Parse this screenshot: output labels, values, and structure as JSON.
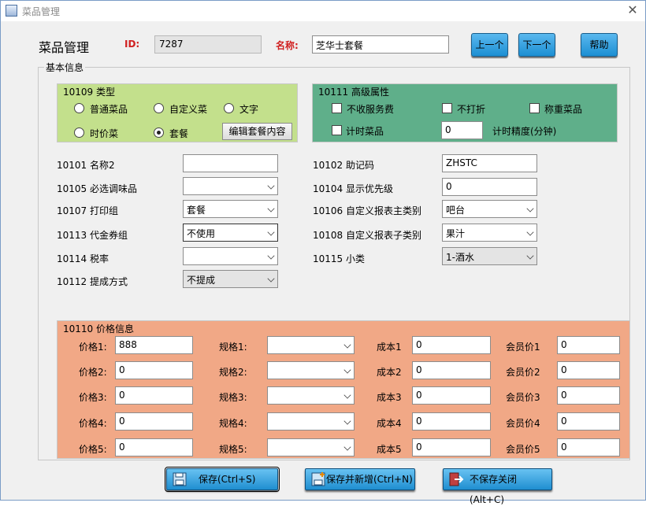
{
  "window": {
    "title": "菜品管理",
    "close_icon": "close-icon"
  },
  "header": {
    "title": "菜品管理",
    "id_label": "ID:",
    "id_value": "7287",
    "name_label": "名称:",
    "name_value": "芝华士套餐",
    "prev": "上一个",
    "next": "下一个",
    "help": "帮助"
  },
  "basic": {
    "group_label": "基本信息"
  },
  "type_group": {
    "label": "10109 类型",
    "options": [
      "普通菜品",
      "自定义菜",
      "文字",
      "时价菜",
      "套餐"
    ],
    "selected": "套餐",
    "edit_btn": "编辑套餐内容"
  },
  "advanced": {
    "label": "10111 高级属性",
    "no_service": "不收服务费",
    "no_discount": "不打折",
    "weigh": "称重菜品",
    "timed": "计时菜品",
    "precision_value": "0",
    "precision_label": "计时精度(分钟)"
  },
  "fields": {
    "name2_label": "10101 名称2",
    "name2_value": "",
    "mnemonic_label": "10102 助记码",
    "mnemonic_value": "ZHSTC",
    "seasoning_label": "10105 必选调味品",
    "seasoning_value": "",
    "priority_label": "10104 显示优先级",
    "priority_value": "0",
    "print_label": "10107 打印组",
    "print_value": "套餐",
    "report_main_label": "10106 自定义报表主类别",
    "report_main_value": "吧台",
    "coupon_label": "10113 代金券组",
    "coupon_value": "不使用",
    "report_sub_label": "10108 自定义报表子类别",
    "report_sub_value": "果汁",
    "tax_label": "10114 税率",
    "tax_value": "",
    "subclass_label": "10115 小类",
    "subclass_value": "1-酒水",
    "commission_label": "10112 提成方式",
    "commission_value": "不提成"
  },
  "price": {
    "label": "10110 价格信息",
    "rows": [
      {
        "price_label": "价格1:",
        "price": "888",
        "spec_label": "规格1:",
        "spec": "",
        "cost_label": "成本1",
        "cost": "0",
        "member_label": "会员价1",
        "member": "0"
      },
      {
        "price_label": "价格2:",
        "price": "0",
        "spec_label": "规格2:",
        "spec": "",
        "cost_label": "成本2",
        "cost": "0",
        "member_label": "会员价2",
        "member": "0"
      },
      {
        "price_label": "价格3:",
        "price": "0",
        "spec_label": "规格3:",
        "spec": "",
        "cost_label": "成本3",
        "cost": "0",
        "member_label": "会员价3",
        "member": "0"
      },
      {
        "price_label": "价格4:",
        "price": "0",
        "spec_label": "规格4:",
        "spec": "",
        "cost_label": "成本4",
        "cost": "0",
        "member_label": "会员价4",
        "member": "0"
      },
      {
        "price_label": "价格5:",
        "price": "0",
        "spec_label": "规格5:",
        "spec": "",
        "cost_label": "成本5",
        "cost": "0",
        "member_label": "会员价5",
        "member": "0"
      }
    ]
  },
  "footer": {
    "save": "保存(Ctrl+S)",
    "save_new": "保存并新增(Ctrl+N)",
    "close_nosave": "不保存关闭(Alt+C)"
  },
  "colors": {
    "green": "#c3e08c",
    "teal": "#5faf8a",
    "orange": "#f1a886",
    "button_blue": "#1c8fd3",
    "label_red": "#d02020"
  }
}
